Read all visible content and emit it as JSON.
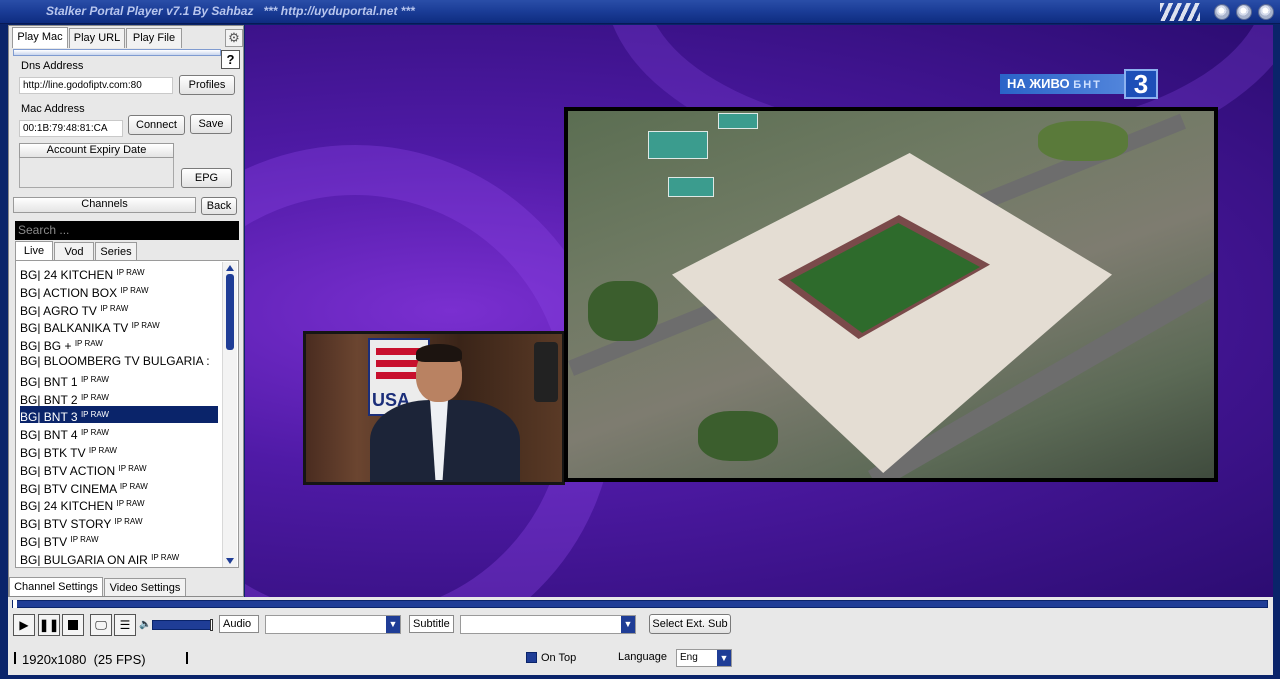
{
  "window": {
    "title": "Stalker Portal Player v7.1 By Sahbaz   *** http://uyduportal.net ***"
  },
  "tabs": [
    "Play Mac",
    "Play URL",
    "Play File"
  ],
  "dns": {
    "label": "Dns Address",
    "value": "http://line.godofiptv.com:80",
    "profiles_button": "Profiles"
  },
  "mac": {
    "label": "Mac Address",
    "value": "00:1B:79:48:81:CA",
    "connect_button": "Connect",
    "save_button": "Save"
  },
  "account": {
    "label": "Account Expiry Date",
    "value": ""
  },
  "epg_button": "EPG",
  "channels": {
    "label": "Channels",
    "back_button": "Back"
  },
  "search": {
    "placeholder": "Search ..."
  },
  "subtabs": [
    "Live",
    "Vod",
    "Series"
  ],
  "channel_tag": "IP RAW",
  "channel_list": [
    "BG| 24 KITCHEN",
    "BG| ACTION BOX",
    "BG| AGRO TV",
    "BG| BALKANIKA TV",
    "BG| BG +",
    "BG| BLOOMBERG TV BULGARIA :",
    "BG| BNT 1",
    "BG| BNT 2",
    "BG| BNT 3",
    "BG| BNT 4",
    "BG| BTK TV",
    "BG| BTV ACTION",
    "BG| BTV CINEMA",
    "BG| 24 KITCHEN",
    "BG| BTV STORY",
    "BG| BTV",
    "BG| BULGARIA ON AIR"
  ],
  "selected_channel_index": 8,
  "settings_tabs": [
    "Channel Settings",
    "Video Settings"
  ],
  "video": {
    "logo_live": "НА ЖИВО",
    "logo_brand": "БНТ",
    "logo_number": "3",
    "flag_text": "USA"
  },
  "controls": {
    "audio_label": "Audio",
    "subtitle_label": "Subtitle",
    "ext_sub_button": "Select Ext. Sub",
    "resolution": "1920x1080  (25 FPS)",
    "on_top_label": "On Top",
    "language_label": "Language",
    "language_value": "Eng"
  },
  "colors": {
    "accent": "#1f3d96",
    "selection": "#0a246a",
    "titlebar": "#1a3c96"
  }
}
